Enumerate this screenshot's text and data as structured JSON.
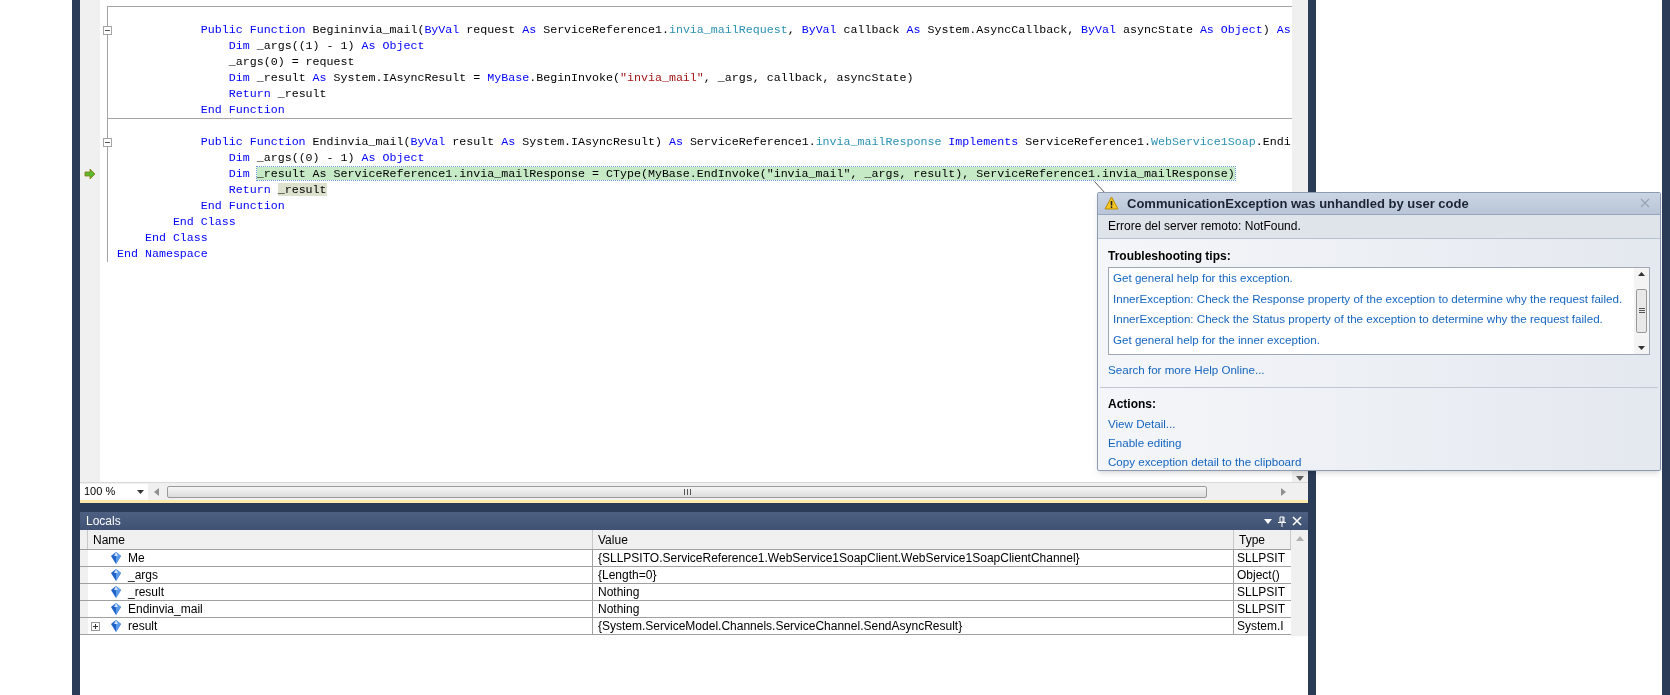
{
  "editor": {
    "lines": [
      {
        "kind": "separator"
      },
      {
        "kind": "code",
        "collapsible": true,
        "current": false,
        "segments": [
          {
            "text": "            Public Function",
            "kind": "keyword"
          },
          {
            "text": " Begininvia_mail(",
            "kind": "plain"
          },
          {
            "text": "ByVal",
            "kind": "keyword"
          },
          {
            "text": " request ",
            "kind": "plain"
          },
          {
            "text": "As",
            "kind": "keyword"
          },
          {
            "text": " ServiceReference1.",
            "kind": "plain"
          },
          {
            "text": "invia_mailRequest",
            "kind": "type"
          },
          {
            "text": ", ",
            "kind": "plain"
          },
          {
            "text": "ByVal",
            "kind": "keyword"
          },
          {
            "text": " callback ",
            "kind": "plain"
          },
          {
            "text": "As",
            "kind": "keyword"
          },
          {
            "text": " System.AsyncCallback, ",
            "kind": "plain"
          },
          {
            "text": "ByVal",
            "kind": "keyword"
          },
          {
            "text": " asyncState ",
            "kind": "plain"
          },
          {
            "text": "As Object",
            "kind": "keyword"
          },
          {
            "text": ") ",
            "kind": "plain"
          },
          {
            "text": "As",
            "kind": "keyword"
          }
        ]
      },
      {
        "kind": "code",
        "collapsible": false,
        "current": false,
        "segments": [
          {
            "text": "                Dim",
            "kind": "keyword"
          },
          {
            "text": " _args((1) - 1) ",
            "kind": "plain"
          },
          {
            "text": "As Object",
            "kind": "keyword"
          }
        ]
      },
      {
        "kind": "code",
        "collapsible": false,
        "current": false,
        "segments": [
          {
            "text": "                _args(0) = request",
            "kind": "plain"
          }
        ]
      },
      {
        "kind": "code",
        "collapsible": false,
        "current": false,
        "segments": [
          {
            "text": "                Dim",
            "kind": "keyword"
          },
          {
            "text": " _result ",
            "kind": "plain"
          },
          {
            "text": "As",
            "kind": "keyword"
          },
          {
            "text": " System.IAsyncResult = ",
            "kind": "plain"
          },
          {
            "text": "MyBase",
            "kind": "keyword"
          },
          {
            "text": ".BeginInvoke(",
            "kind": "plain"
          },
          {
            "text": "\"invia_mail\"",
            "kind": "string"
          },
          {
            "text": ", _args, callback, asyncState)",
            "kind": "plain"
          }
        ]
      },
      {
        "kind": "code",
        "collapsible": false,
        "current": false,
        "segments": [
          {
            "text": "                Return",
            "kind": "keyword"
          },
          {
            "text": " _result",
            "kind": "plain"
          }
        ]
      },
      {
        "kind": "code",
        "collapsible": false,
        "current": false,
        "segments": [
          {
            "text": "            End Function",
            "kind": "keyword"
          }
        ]
      },
      {
        "kind": "separator"
      },
      {
        "kind": "code",
        "collapsible": true,
        "current": false,
        "segments": [
          {
            "text": "            Public Function",
            "kind": "keyword"
          },
          {
            "text": " Endinvia_mail(",
            "kind": "plain"
          },
          {
            "text": "ByVal",
            "kind": "keyword"
          },
          {
            "text": " result ",
            "kind": "plain"
          },
          {
            "text": "As",
            "kind": "keyword"
          },
          {
            "text": " System.IAsyncResult) ",
            "kind": "plain"
          },
          {
            "text": "As",
            "kind": "keyword"
          },
          {
            "text": " ServiceReference1.",
            "kind": "plain"
          },
          {
            "text": "invia_mailResponse",
            "kind": "type"
          },
          {
            "text": " Implements",
            "kind": "keyword"
          },
          {
            "text": " ServiceReference1.",
            "kind": "plain"
          },
          {
            "text": "WebService1Soap",
            "kind": "type"
          },
          {
            "text": ".Endi",
            "kind": "plain"
          }
        ]
      },
      {
        "kind": "code",
        "collapsible": false,
        "current": false,
        "segments": [
          {
            "text": "                Dim",
            "kind": "keyword"
          },
          {
            "text": " _args((0) - 1) ",
            "kind": "plain"
          },
          {
            "text": "As Object",
            "kind": "keyword"
          }
        ]
      },
      {
        "kind": "code",
        "collapsible": false,
        "current": true,
        "segments": [
          {
            "text": "                Dim ",
            "kind": "keyword"
          },
          {
            "text": "_result As ServiceReference1.invia_mailResponse = CType(MyBase.EndInvoke(\"invia_mail\", _args, result), ServiceReference1.invia_mailResponse)",
            "kind": "statement"
          }
        ]
      },
      {
        "kind": "code",
        "collapsible": false,
        "current": false,
        "segments": [
          {
            "text": "                Return ",
            "kind": "keyword"
          },
          {
            "text": "_result",
            "kind": "reference"
          }
        ]
      },
      {
        "kind": "code",
        "collapsible": false,
        "current": false,
        "segments": [
          {
            "text": "            End Function",
            "kind": "keyword"
          }
        ]
      },
      {
        "kind": "code",
        "collapsible": false,
        "current": false,
        "segments": [
          {
            "text": "        End Class",
            "kind": "keyword"
          }
        ]
      },
      {
        "kind": "code",
        "collapsible": false,
        "current": false,
        "segments": [
          {
            "text": "    End Class",
            "kind": "keyword"
          }
        ]
      },
      {
        "kind": "code",
        "collapsible": false,
        "current": false,
        "segments": [
          {
            "text": "End Namespace",
            "kind": "keyword"
          }
        ]
      }
    ],
    "zoom": "100 %"
  },
  "exception_popup": {
    "title": "CommunicationException was unhandled by user code",
    "message": "Errore del server remoto: NotFound.",
    "tips_heading": "Troubleshooting tips:",
    "tips": [
      "Get general help for this exception.",
      "InnerException: Check the Response property of the exception to determine why the request failed.",
      "InnerException: Check the Status property of the exception to determine why the request failed.",
      "Get general help for the inner exception."
    ],
    "search_link": "Search for more Help Online...",
    "actions_heading": "Actions:",
    "actions": [
      "View Detail...",
      "Enable editing",
      "Copy exception detail to the clipboard"
    ]
  },
  "locals": {
    "title": "Locals",
    "columns": [
      "Name",
      "Value",
      "Type"
    ],
    "rows": [
      {
        "name": "Me",
        "value": "{SLLPSITO.ServiceReference1.WebService1SoapClient.WebService1SoapClientChannel}",
        "type": "SLLPSIT",
        "expandable": false
      },
      {
        "name": "_args",
        "value": "{Length=0}",
        "type": "Object()",
        "expandable": false
      },
      {
        "name": "_result",
        "value": "Nothing",
        "type": "SLLPSIT",
        "expandable": false
      },
      {
        "name": "Endinvia_mail",
        "value": "Nothing",
        "type": "SLLPSIT",
        "expandable": false
      },
      {
        "name": "result",
        "value": "{System.ServiceModel.Channels.ServiceChannel.SendAsyncResult}",
        "type": "System.I",
        "expandable": true
      }
    ]
  }
}
